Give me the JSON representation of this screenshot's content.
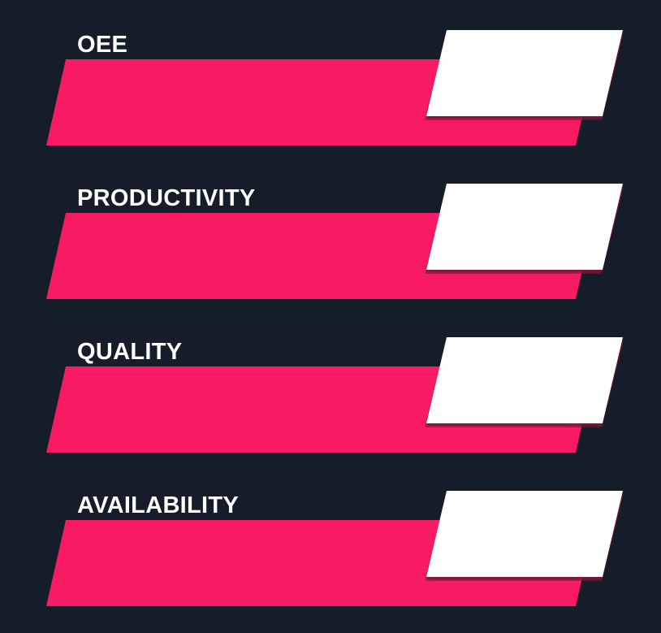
{
  "theme": {
    "background": "#161d2a",
    "accent": "#f81a63",
    "shadow": "#7a1737",
    "box": "#ffffff",
    "label_color": "#ffffff"
  },
  "kpis": [
    {
      "label": "OEE"
    },
    {
      "label": "PRODUCTIVITY"
    },
    {
      "label": "QUALITY"
    },
    {
      "label": "AVAILABILITY"
    }
  ]
}
